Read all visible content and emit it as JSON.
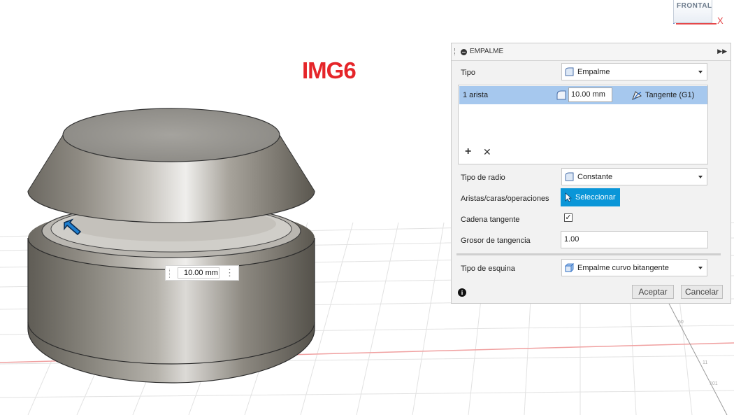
{
  "viewport": {
    "img_label": "IMG6",
    "viewcube_face": "FRONTAL",
    "axis_x_label": "X",
    "dimension_value": "10.00 mm",
    "grid_labels": [
      "50",
      "11",
      "101"
    ]
  },
  "panel": {
    "title": "EMPALME",
    "tipo_label": "Tipo",
    "tipo_value": "Empalme",
    "edge_row": {
      "count": "1 arista",
      "radius": "10.00 mm",
      "continuity": "Tangente (G1)"
    },
    "tipo_radio_label": "Tipo de radio",
    "tipo_radio_value": "Constante",
    "aristas_label": "Aristas/caras/operaciones",
    "select_button": "Seleccionar",
    "cadena_label": "Cadena tangente",
    "cadena_checked": "✓",
    "grosor_label": "Grosor de tangencia",
    "grosor_value": "1.00",
    "esquina_label": "Tipo de esquina",
    "esquina_value": "Empalme curvo bitangente",
    "ok_button": "Aceptar",
    "cancel_button": "Cancelar"
  },
  "colors": {
    "accent": "#0a96d8",
    "selection": "#a6c8ee",
    "label_red": "#e52529"
  }
}
